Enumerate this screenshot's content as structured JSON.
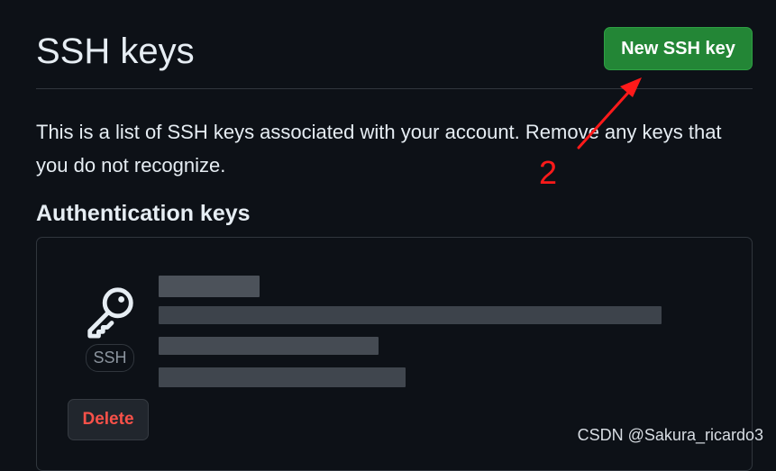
{
  "header": {
    "title": "SSH keys",
    "new_key_label": "New SSH key"
  },
  "intro": {
    "text": "This is a list of SSH keys associated with your account. Remove any keys that you do not recognize."
  },
  "section": {
    "heading": "Authentication keys"
  },
  "key_entry": {
    "badge": "SSH",
    "delete_label": "Delete"
  },
  "annotation": {
    "number": "2",
    "color": "#ff1a1a"
  },
  "watermark": {
    "text": "CSDN @Sakura_ricardo3"
  },
  "colors": {
    "background": "#0d1117",
    "primary_button": "#238636",
    "danger_text": "#f85149",
    "border": "#30363d"
  },
  "icons": {
    "key": "key-icon",
    "arrow": "annotation-arrow"
  }
}
